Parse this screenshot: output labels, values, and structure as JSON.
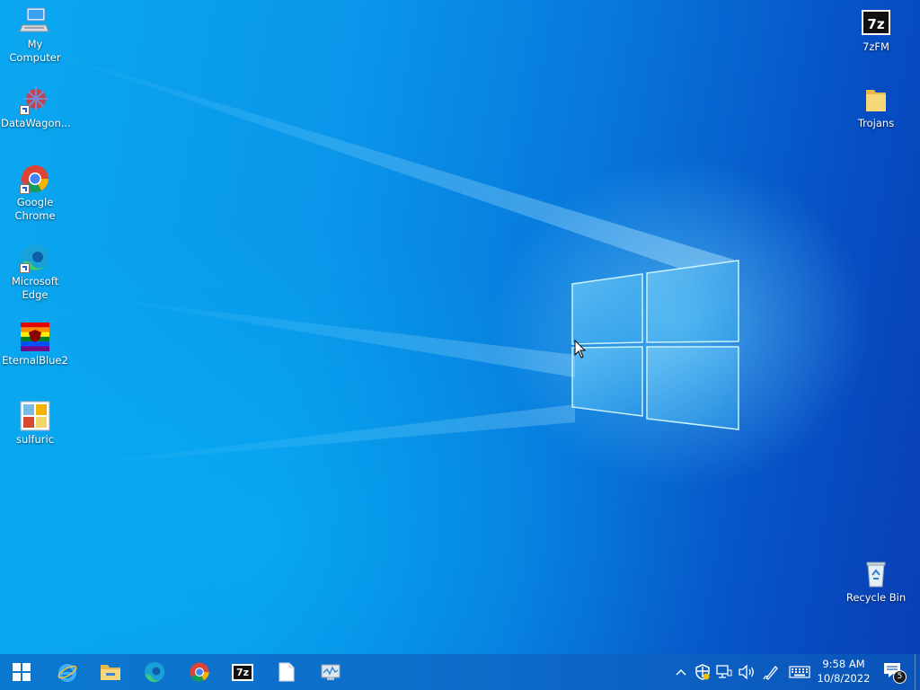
{
  "desktop": {
    "icons_left": [
      {
        "label": "My Computer"
      },
      {
        "label": "DataWagon..."
      },
      {
        "label": "Google Chrome"
      },
      {
        "label": "Microsoft Edge"
      },
      {
        "label": "EternalBlue2"
      },
      {
        "label": "sulfuric"
      }
    ],
    "icons_right": [
      {
        "label": "7zFM"
      },
      {
        "label": "Trojans"
      },
      {
        "label": "Recycle Bin"
      }
    ]
  },
  "taskbar": {
    "pinned": [
      {
        "icon": "windows-start-icon"
      },
      {
        "icon": "internet-explorer-icon"
      },
      {
        "icon": "file-explorer-icon"
      },
      {
        "icon": "edge-icon"
      },
      {
        "icon": "chrome-icon"
      },
      {
        "icon": "7zip-icon"
      },
      {
        "icon": "blank-document-icon"
      },
      {
        "icon": "system-monitor-icon"
      }
    ],
    "tray": {
      "time": "9:58 AM",
      "date": "10/8/2022",
      "notification_count": "5"
    },
    "seven_zip_text": "7z"
  },
  "colors": {
    "taskbar": "#0b6fcb",
    "desktop_accent": "#0a96ea"
  }
}
